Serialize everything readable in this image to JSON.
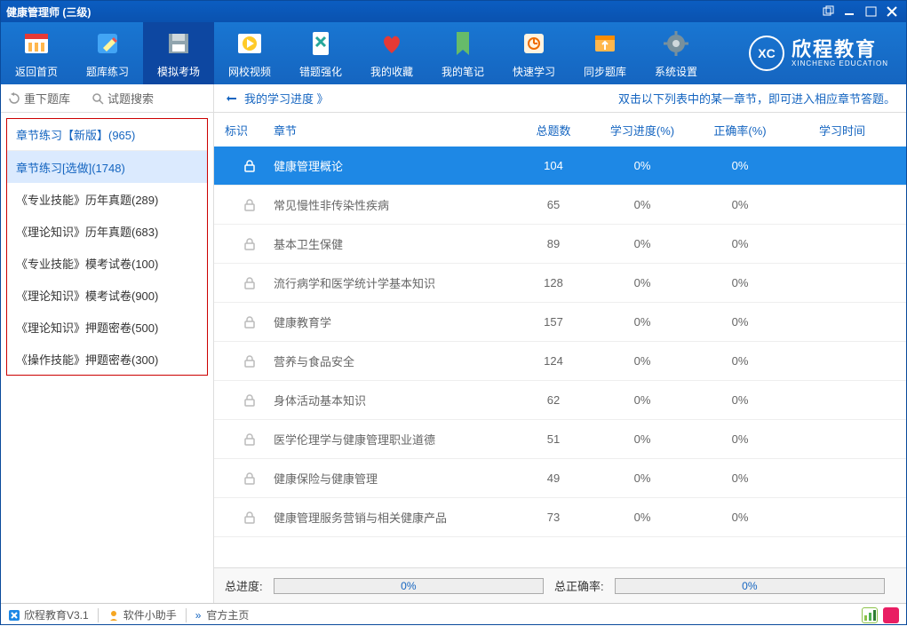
{
  "window": {
    "title": "健康管理师 (三级)"
  },
  "toolbar": [
    {
      "label": "返回首页"
    },
    {
      "label": "题库练习"
    },
    {
      "label": "模拟考场",
      "active": true
    },
    {
      "label": "网校视频"
    },
    {
      "label": "错题强化"
    },
    {
      "label": "我的收藏"
    },
    {
      "label": "我的笔记"
    },
    {
      "label": "快速学习"
    },
    {
      "label": "同步题库"
    },
    {
      "label": "系统设置"
    }
  ],
  "brand": {
    "logo": "XC",
    "name": "欣程教育",
    "sub": "XINCHENG EDUCATION"
  },
  "sidebar": {
    "top": {
      "reset": "重下题库",
      "search": "试题搜索"
    },
    "items": [
      {
        "label": "章节练习【新版】(965)",
        "cls": "new"
      },
      {
        "label": "章节练习[选做](1748)",
        "cls": "sel"
      },
      {
        "label": "《专业技能》历年真题(289)"
      },
      {
        "label": "《理论知识》历年真题(683)"
      },
      {
        "label": "《专业技能》模考试卷(100)"
      },
      {
        "label": "《理论知识》模考试卷(900)"
      },
      {
        "label": "《理论知识》押题密卷(500)"
      },
      {
        "label": "《操作技能》押题密卷(300)"
      }
    ]
  },
  "main": {
    "progress_link": "我的学习进度 》",
    "hint": "双击以下列表中的某一章节，即可进入相应章节答题。",
    "columns": {
      "flag": "标识",
      "chapter": "章节",
      "total": "总题数",
      "progress": "学习进度(%)",
      "correct": "正确率(%)",
      "time": "学习时间"
    },
    "rows": [
      {
        "name": "健康管理概论",
        "total": 104,
        "prog": "0%",
        "corr": "0%",
        "active": true
      },
      {
        "name": "常见慢性非传染性疾病",
        "total": 65,
        "prog": "0%",
        "corr": "0%"
      },
      {
        "name": "基本卫生保健",
        "total": 89,
        "prog": "0%",
        "corr": "0%"
      },
      {
        "name": "流行病学和医学统计学基本知识",
        "total": 128,
        "prog": "0%",
        "corr": "0%"
      },
      {
        "name": "健康教育学",
        "total": 157,
        "prog": "0%",
        "corr": "0%"
      },
      {
        "name": "营养与食品安全",
        "total": 124,
        "prog": "0%",
        "corr": "0%"
      },
      {
        "name": "身体活动基本知识",
        "total": 62,
        "prog": "0%",
        "corr": "0%"
      },
      {
        "name": "医学伦理学与健康管理职业道德",
        "total": 51,
        "prog": "0%",
        "corr": "0%"
      },
      {
        "name": "健康保险与健康管理",
        "total": 49,
        "prog": "0%",
        "corr": "0%"
      },
      {
        "name": "健康管理服务营销与相关健康产品",
        "total": 73,
        "prog": "0%",
        "corr": "0%"
      }
    ],
    "footer": {
      "total_label": "总进度:",
      "total_val": "0%",
      "corr_label": "总正确率:",
      "corr_val": "0%"
    }
  },
  "status": {
    "version": "欣程教育V3.1",
    "helper": "软件小助手",
    "home": "官方主页"
  }
}
